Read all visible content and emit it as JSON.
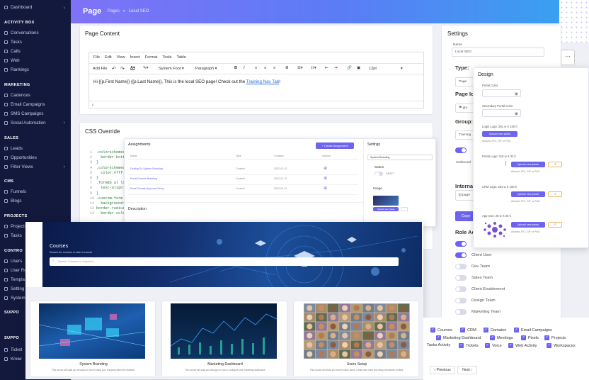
{
  "sidebar": {
    "top_item": "Dashboard",
    "sections": [
      {
        "title": "ACTIVITY BOX",
        "items": [
          "Conversations",
          "Tasks",
          "Calls",
          "Web",
          "Rankings"
        ]
      },
      {
        "title": "MARKETING",
        "items": [
          "Cadences",
          "Email Campaigns",
          "SMS Campaigns",
          "Social Automation"
        ]
      },
      {
        "title": "SALES",
        "items": [
          "Leads",
          "Opportunities",
          "Filter Views"
        ]
      },
      {
        "title": "CMS",
        "items": [
          "Funnels",
          "Blogs"
        ]
      },
      {
        "title": "PROJECTS",
        "items": [
          "Projects",
          "Tasks"
        ]
      },
      {
        "title": "CONTRO",
        "items": [
          "Users",
          "User Ro",
          "Templa",
          "Setting",
          "System"
        ]
      },
      {
        "title": "SUPPO",
        "items": []
      },
      {
        "title": "SUPPO",
        "items": [
          "Ticket",
          "Know"
        ]
      }
    ]
  },
  "header": {
    "title": "Page",
    "crumb_1": "Pages",
    "crumb_sep": "»",
    "crumb_2": "Local SEO"
  },
  "page_content": {
    "title": "Page Content",
    "menu": [
      "File",
      "Edit",
      "View",
      "Insert",
      "Format",
      "Tools",
      "Table"
    ],
    "add_file": "Add File",
    "font": "System Font",
    "block": "Paragraph",
    "size": "12pt",
    "body_text": "Hi {{p.First Name}} {{p.Last Name}}, This is the local SEO page!  Check out the ",
    "link_text": "Training Nav Tab",
    "body_end": "!",
    "status": "p"
  },
  "css_override": {
    "title": "CSS Override",
    "lines": [
      {
        "n": "1",
        "t": ".colorschemeo"
      },
      {
        "n": "2",
        "t": "  border-bott"
      },
      {
        "n": "3",
        "t": "}"
      },
      {
        "n": "4",
        "t": ".colorschemeo"
      },
      {
        "n": "5",
        "t": "  color:#fff"
      },
      {
        "n": "6",
        "t": "}"
      },
      {
        "n": "7",
        "t": ".form85 ul li"
      },
      {
        "n": "8",
        "t": "  text-align:"
      },
      {
        "n": "9",
        "t": "}"
      },
      {
        "n": "10",
        "t": ".custom-form"
      },
      {
        "n": "11",
        "t": "  background:"
      },
      {
        "n": "12",
        "t": "border-radius"
      },
      {
        "n": "13",
        "t": "  border-colo"
      }
    ]
  },
  "settings": {
    "title": "Settings",
    "name_label": "Name",
    "name_value": "Local SEO",
    "type_label": "Type:",
    "type_value": "Page",
    "page_icon_label": "Page Ic",
    "page_icon_value": "gla",
    "group_label": "Group:",
    "group_value": "Training",
    "outbound_label": "Outbound",
    "internal_label": "Internal",
    "internal_value": "[[cpage",
    "copy_btn": "Copy",
    "role_label": "Role Ac",
    "roles": [
      {
        "name": "Client User",
        "on": true
      },
      {
        "name": "Dev Team",
        "on": false
      },
      {
        "name": "Sales Team",
        "on": false
      },
      {
        "name": "Client Enablement",
        "on": false
      },
      {
        "name": "Design Team",
        "on": false
      },
      {
        "name": "Marketing Team",
        "on": false
      }
    ]
  },
  "design": {
    "title": "Design",
    "portal_color": "Portal Color",
    "secondary_color": "Secondary Portal Color",
    "login_logo": "Login Logo: 281 w X 100 h",
    "portal_logo": "Portal Logo: 115 w X 32 h",
    "crm_logo": "CRM Logo: 281 w X 100 h",
    "app_icon": "App Icon: 25 w X 25 h",
    "upload_btn": "Upload new photo",
    "allowed": "Allowed JPG, GIF or PNG"
  },
  "assignments": {
    "title": "Assignments",
    "create_btn": "+ Create Assignment",
    "columns": [
      "Name",
      "Type",
      "Creation",
      "Actions"
    ],
    "rows": [
      {
        "name": "Getting Go System Branding",
        "type": "Content",
        "date": "2022-01-13"
      },
      {
        "name": "Portal Domain Branding",
        "type": "Content",
        "date": "2022-01-13"
      },
      {
        "name": "Email Domain Approval Setup",
        "type": "Content",
        "date": "2022-01-13"
      }
    ],
    "description_label": "Description",
    "settings_title": "Settings",
    "name_value": "System Branding",
    "status_label": "Status",
    "status_value": "DRAFT",
    "image_label": "Image",
    "upload_image": "Upload new image"
  },
  "courses": {
    "title": "Courses",
    "subtitle": "Search for courses or start a course",
    "search_placeholder": "Search Courses or Keyword",
    "cards": [
      {
        "title": "System Branding",
        "desc": "This course will walk you through on how to setup your branding within the platform."
      },
      {
        "title": "Marketing Dashboard",
        "desc": "This course will walk you through on how to configure your marketing dashboard."
      },
      {
        "title": "Users Setup",
        "desc": "This course will show you how to setup users, create user roles and setup permission profiles."
      }
    ]
  },
  "permissions": {
    "row1": [
      "Courses",
      "CRM",
      "Domains",
      "Email Campaigns"
    ],
    "row2": [
      "Marketing Dashboard",
      "Meetings",
      "Pixels",
      "Projects"
    ],
    "row3": [
      "Tasks Activity",
      "Tickets",
      "Voice",
      "Web Activity",
      "Workspaces"
    ]
  },
  "pagination": {
    "prev": "‹ Previous",
    "next": "Next ›"
  },
  "colors": {
    "accent": "#6c63f0",
    "sidebar": "#13193d",
    "header_start": "#7f72f7",
    "header_end": "#3aa0f0"
  }
}
